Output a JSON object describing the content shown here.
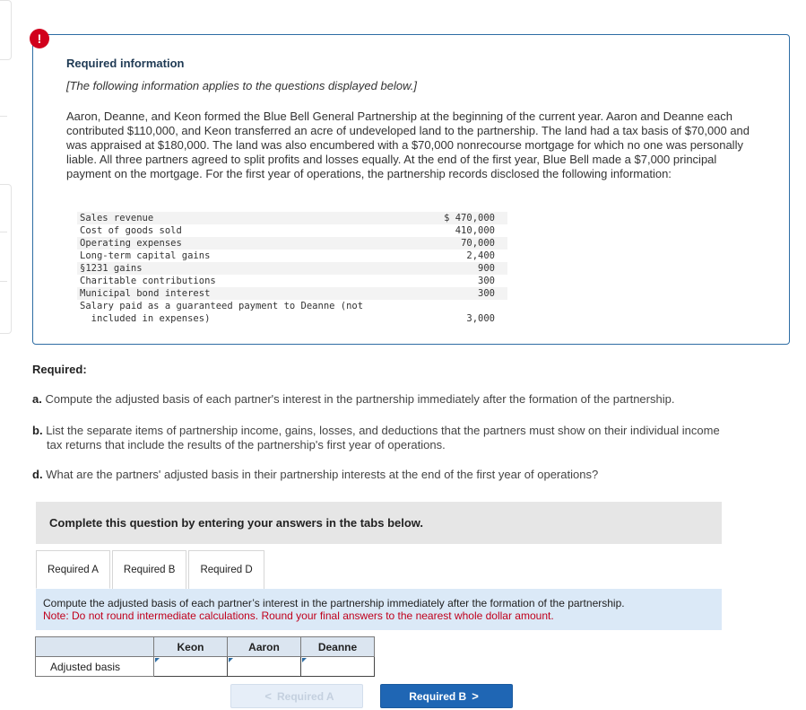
{
  "alert": {
    "icon": "!"
  },
  "info": {
    "title": "Required information",
    "subtitle": "[The following information applies to the questions displayed below.]",
    "paragraph": "Aaron, Deanne, and Keon formed the Blue Bell General Partnership at the beginning of the current year. Aaron and Deanne each contributed $110,000, and Keon transferred an acre of undeveloped land to the partnership. The land had a tax basis of $70,000 and was appraised at $180,000. The land was also encumbered with a $70,000 nonrecourse mortgage for which no one was personally liable. All three partners agreed to split profits and losses equally. At the end of the first year, Blue Bell made a $7,000 principal payment on the mortgage. For the first year of operations, the partnership records disclosed the following information:",
    "rows": [
      {
        "label": "Sales revenue",
        "value": "$ 470,000"
      },
      {
        "label": "Cost of goods sold",
        "value": "410,000"
      },
      {
        "label": "Operating expenses",
        "value": "70,000"
      },
      {
        "label": "Long-term capital gains",
        "value": "2,400"
      },
      {
        "label": "§1231 gains",
        "value": "900"
      },
      {
        "label": "Charitable contributions",
        "value": "300"
      },
      {
        "label": "Municipal bond interest",
        "value": "300"
      },
      {
        "label": "Salary paid as a guaranteed payment to Deanne (not\n  included in expenses)",
        "value": "3,000"
      }
    ]
  },
  "required": {
    "heading": "Required:",
    "a_prefix": "a.",
    "a_text": "Compute the adjusted basis of each partner's interest in the partnership immediately after the formation of the partnership.",
    "b_prefix": "b.",
    "b_text": "List the separate items of partnership income, gains, losses, and deductions that the partners must show on their individual income",
    "b_text_cont": "tax returns that include the results of the partnership's first year of operations.",
    "d_prefix": "d.",
    "d_text": "What are the partners' adjusted basis in their partnership interests at the end of the first year of operations?"
  },
  "instructions": "Complete this question by entering your answers in the tabs below.",
  "tabs": [
    {
      "label": "Required A",
      "active": true
    },
    {
      "label": "Required B",
      "active": false
    },
    {
      "label": "Required D",
      "active": false
    }
  ],
  "panel": {
    "question": "Compute the adjusted basis of each partner’s interest in the partnership immediately after the formation of the partnership.",
    "note": "Note: Do not round intermediate calculations. Round your final answers to the nearest whole dollar amount."
  },
  "answer_table": {
    "columns": [
      "Keon",
      "Aaron",
      "Deanne"
    ],
    "row_label": "Adjusted basis",
    "values": [
      "",
      "",
      ""
    ]
  },
  "nav": {
    "prev_label": "Required A",
    "prev_chevron": "<",
    "next_label": "Required B",
    "next_chevron": ">"
  },
  "colors": {
    "accent": "#1f66b4",
    "alert": "#d1001c",
    "note": "#c0001c",
    "panel_bg": "#dbe9f7"
  }
}
